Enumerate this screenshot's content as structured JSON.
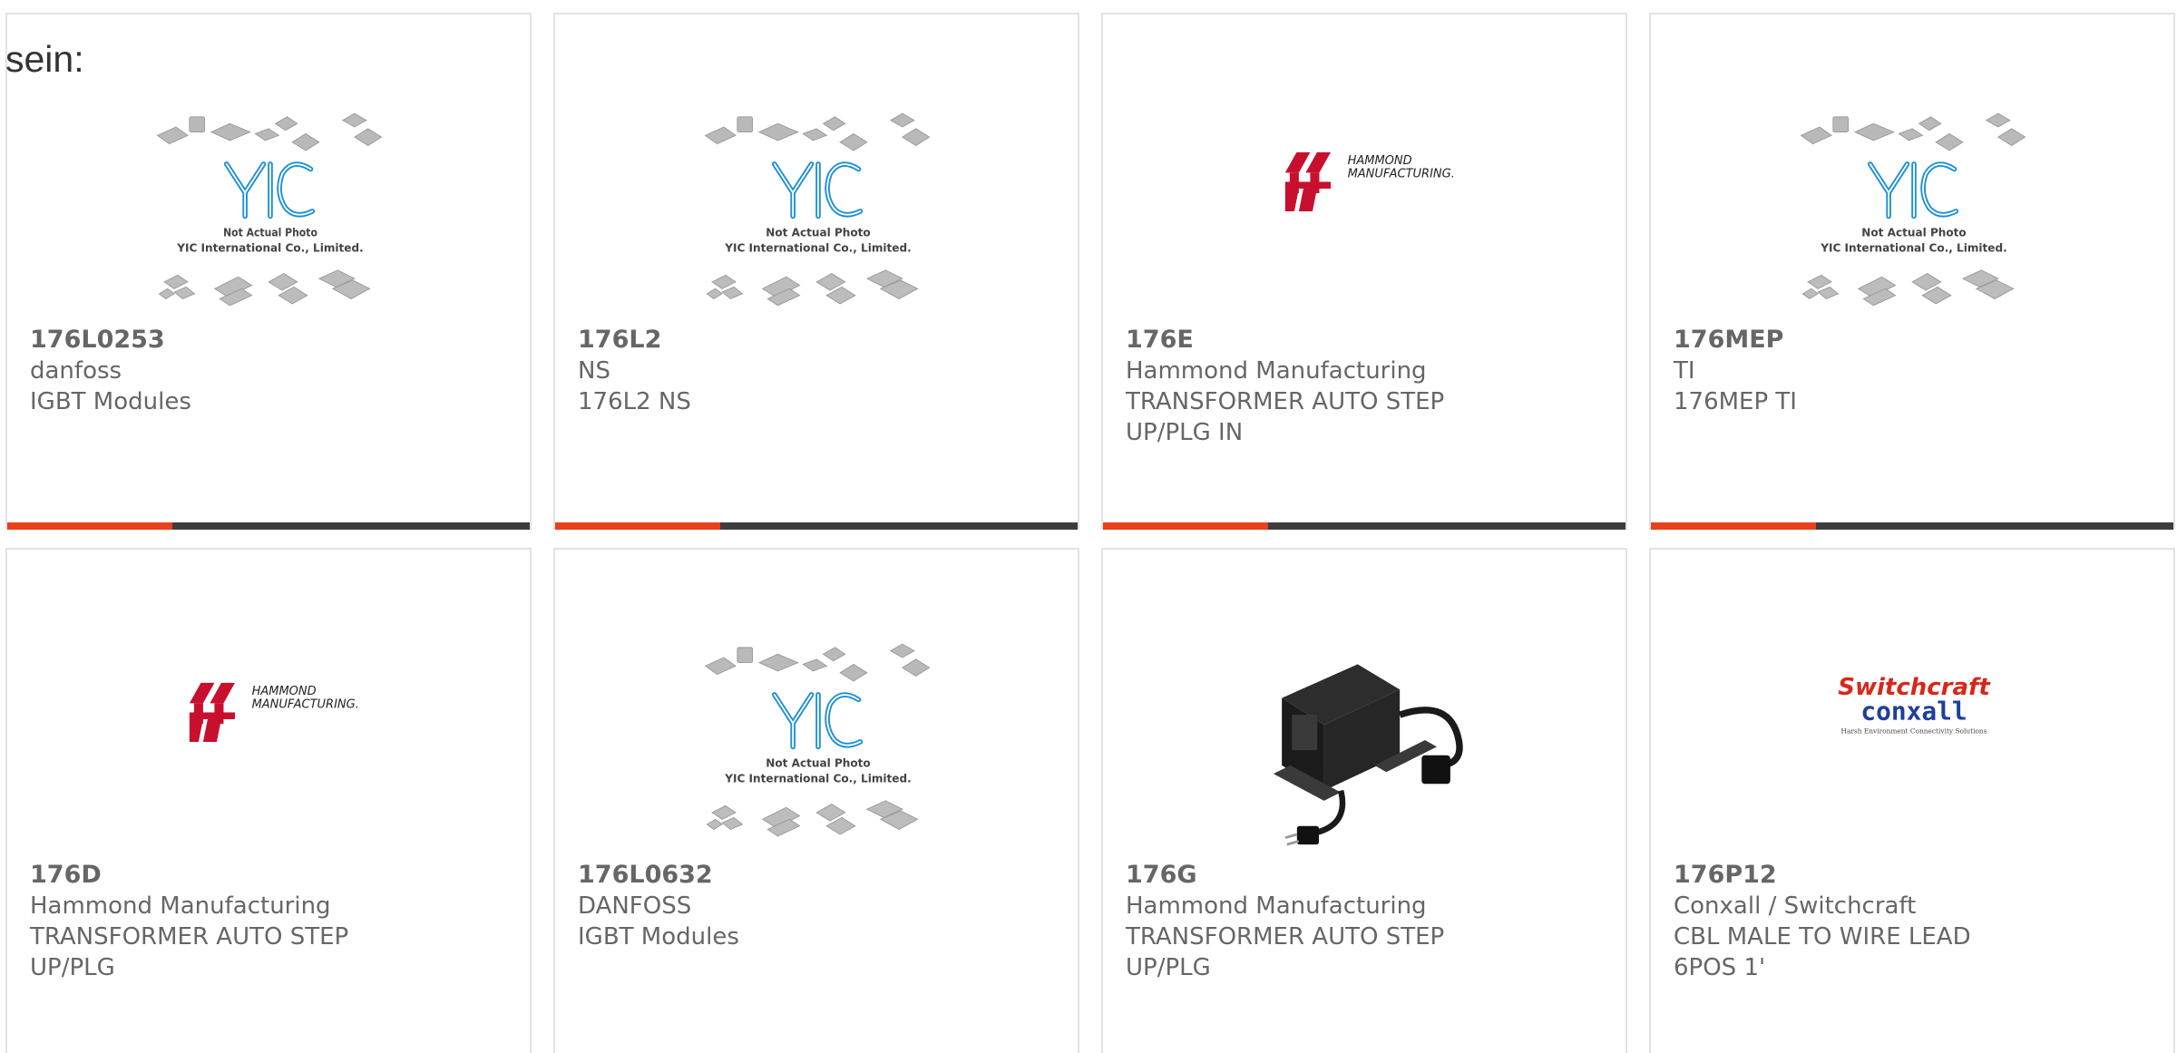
{
  "intro": "sein:",
  "colors": {
    "accent": "#e8401c",
    "bar": "#3d3d3d",
    "border": "#e2e2e2",
    "text": "#666666",
    "yic_blue": "#1a8fd6",
    "hammond_red": "#c8102e",
    "switchcraft_red": "#d6281c",
    "conxall_blue": "#1e3f9a"
  },
  "placeholder_image": {
    "line1": "Not Actual Photo",
    "line2": "YIC International Co., Limited.",
    "logo": "YIC"
  },
  "products": [
    {
      "part": "176L0253",
      "maker": "danfoss",
      "desc": "IGBT Modules",
      "image": "yic-placeholder"
    },
    {
      "part": "176L2",
      "maker": "NS",
      "desc": "176L2 NS",
      "image": "yic-placeholder"
    },
    {
      "part": "176E",
      "maker": "Hammond Manufacturing",
      "desc": "TRANSFORMER AUTO STEP UP/PLG IN",
      "image": "hammond-logo"
    },
    {
      "part": "176MEP",
      "maker": "TI",
      "desc": "176MEP TI",
      "image": "yic-placeholder"
    },
    {
      "part": "176D",
      "maker": "Hammond Manufacturing",
      "desc": "TRANSFORMER AUTO STEP UP/PLG",
      "image": "hammond-logo"
    },
    {
      "part": "176L0632",
      "maker": "DANFOSS",
      "desc": "IGBT Modules",
      "image": "yic-placeholder"
    },
    {
      "part": "176G",
      "maker": "Hammond Manufacturing",
      "desc": "TRANSFORMER AUTO STEP UP/PLG",
      "image": "transformer-photo"
    },
    {
      "part": "176P12",
      "maker": "Conxall / Switchcraft",
      "desc": "CBL MALE TO WIRE LEAD 6POS 1'",
      "image": "switchcraft-conxall-logo"
    }
  ],
  "logos": {
    "hammond": {
      "line1": "HAMMOND",
      "line2": "MANUFACTURING."
    },
    "switchcraft": {
      "line1": "Switchcraft",
      "line2": "conxall",
      "tagline": "Harsh Environment Connectivity Solutions"
    }
  }
}
